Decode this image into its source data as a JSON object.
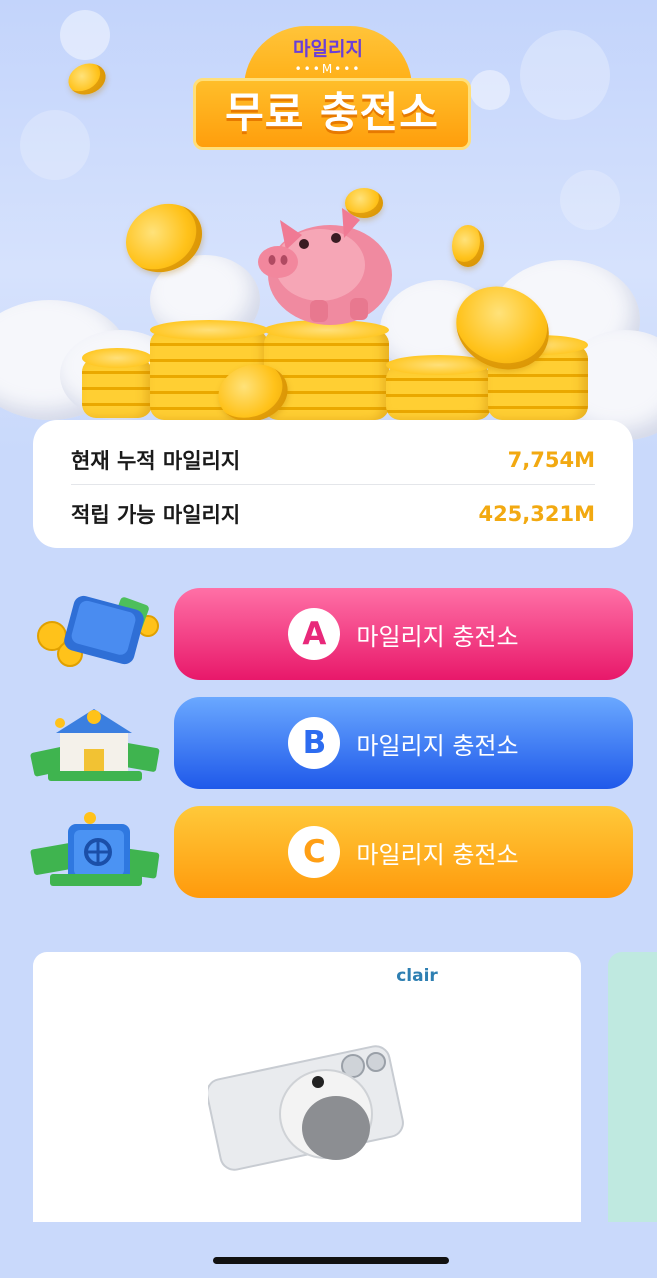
{
  "header": {
    "badge_top": "마일리지",
    "badge_dots": "•••M•••",
    "title": "무료 충전소"
  },
  "summary": {
    "accumulated_label": "현재 누적 마일리지",
    "accumulated_value": "7,754M",
    "available_label": "적립 가능 마일리지",
    "available_value": "425,321M"
  },
  "stations": [
    {
      "letter": "A",
      "label": "마일리지 충전소",
      "icon": "wallet-coins-icon",
      "color": "#e8186a"
    },
    {
      "letter": "B",
      "label": "마일리지 충전소",
      "icon": "bank-money-icon",
      "color": "#1f59ea"
    },
    {
      "letter": "C",
      "label": "마일리지 충전소",
      "icon": "safe-money-icon",
      "color": "#ff9a0c"
    }
  ],
  "ads": {
    "brand": "clair"
  }
}
